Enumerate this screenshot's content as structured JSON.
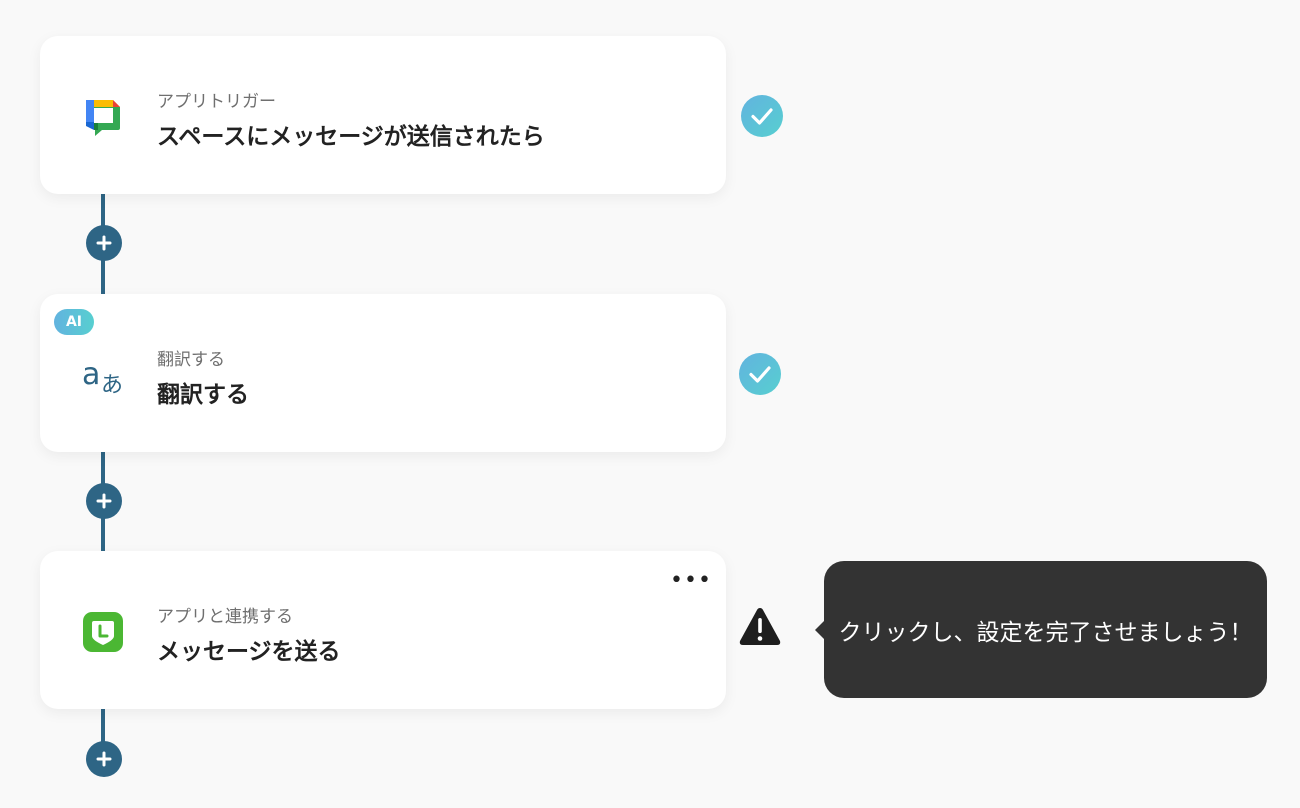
{
  "flow": {
    "steps": [
      {
        "subtitle": "アプリトリガー",
        "title": "スペースにメッセージが送信されたら",
        "icon": "google-chat-icon",
        "status": "completed"
      },
      {
        "badge": "AI",
        "subtitle": "翻訳する",
        "title": "翻訳する",
        "icon": "translate-icon",
        "status": "completed"
      },
      {
        "subtitle": "アプリと連携する",
        "title": "メッセージを送る",
        "icon": "line-works-icon",
        "status": "warning",
        "menu_label": "•••"
      }
    ]
  },
  "tooltip": {
    "text": "クリックし、設定を完了させましょう！"
  },
  "colors": {
    "connector": "#2e6585",
    "check_gradient_start": "#62b3df",
    "check_gradient_end": "#57cfd0",
    "warning": "#1e1e1e",
    "tooltip_bg": "#333333"
  }
}
